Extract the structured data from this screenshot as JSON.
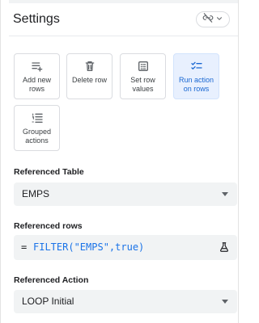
{
  "panel": {
    "title": "Settings",
    "link_icon": "link-off-icon",
    "dropdown_icon": "chevron-down-icon"
  },
  "actions": [
    {
      "label_line1": "Add new",
      "label_line2": "rows",
      "icon": "add-rows-icon",
      "selected": false
    },
    {
      "label_line1": "Delete row",
      "label_line2": "",
      "icon": "delete-icon",
      "selected": false
    },
    {
      "label_line1": "Set row",
      "label_line2": "values",
      "icon": "set-values-icon",
      "selected": false
    },
    {
      "label_line1": "Run action",
      "label_line2": "on rows",
      "icon": "run-action-icon",
      "selected": true
    },
    {
      "label_line1": "Grouped",
      "label_line2": "actions",
      "icon": "grouped-actions-icon",
      "selected": false
    }
  ],
  "referenced_table": {
    "label": "Referenced Table",
    "value": "EMPS"
  },
  "referenced_rows": {
    "label": "Referenced rows",
    "equals": "=",
    "expression": "FILTER(\"EMPS\",true)",
    "test_icon": "flask-icon"
  },
  "referenced_action": {
    "label": "Referenced Action",
    "value": "LOOP Initial"
  },
  "colors": {
    "accent": "#1a73e8",
    "selected_bg": "#e8f0fe",
    "field_bg": "#f1f3f4",
    "border": "#dadce0"
  }
}
